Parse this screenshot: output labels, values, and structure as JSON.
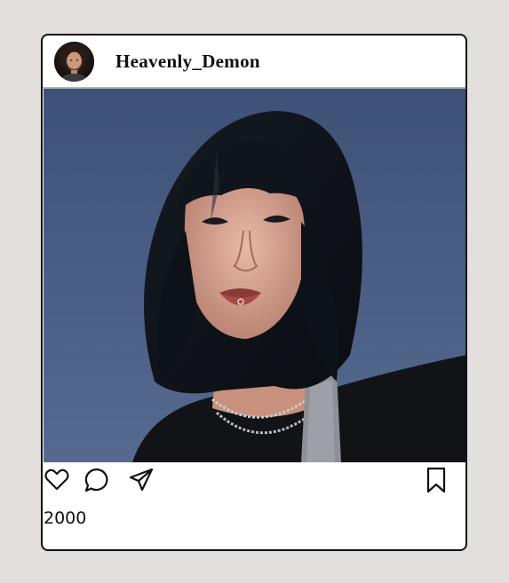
{
  "post": {
    "username": "Heavenly_Demon",
    "likes": "2000"
  },
  "icons": {
    "like": "heart-icon",
    "comment": "comment-bubble-icon",
    "share": "paper-plane-icon",
    "save": "bookmark-icon"
  },
  "colors": {
    "page_background": "#e3dfdf",
    "card_background": "#ffffff",
    "border": "#111111",
    "photo_background": "#4a5a7c"
  }
}
